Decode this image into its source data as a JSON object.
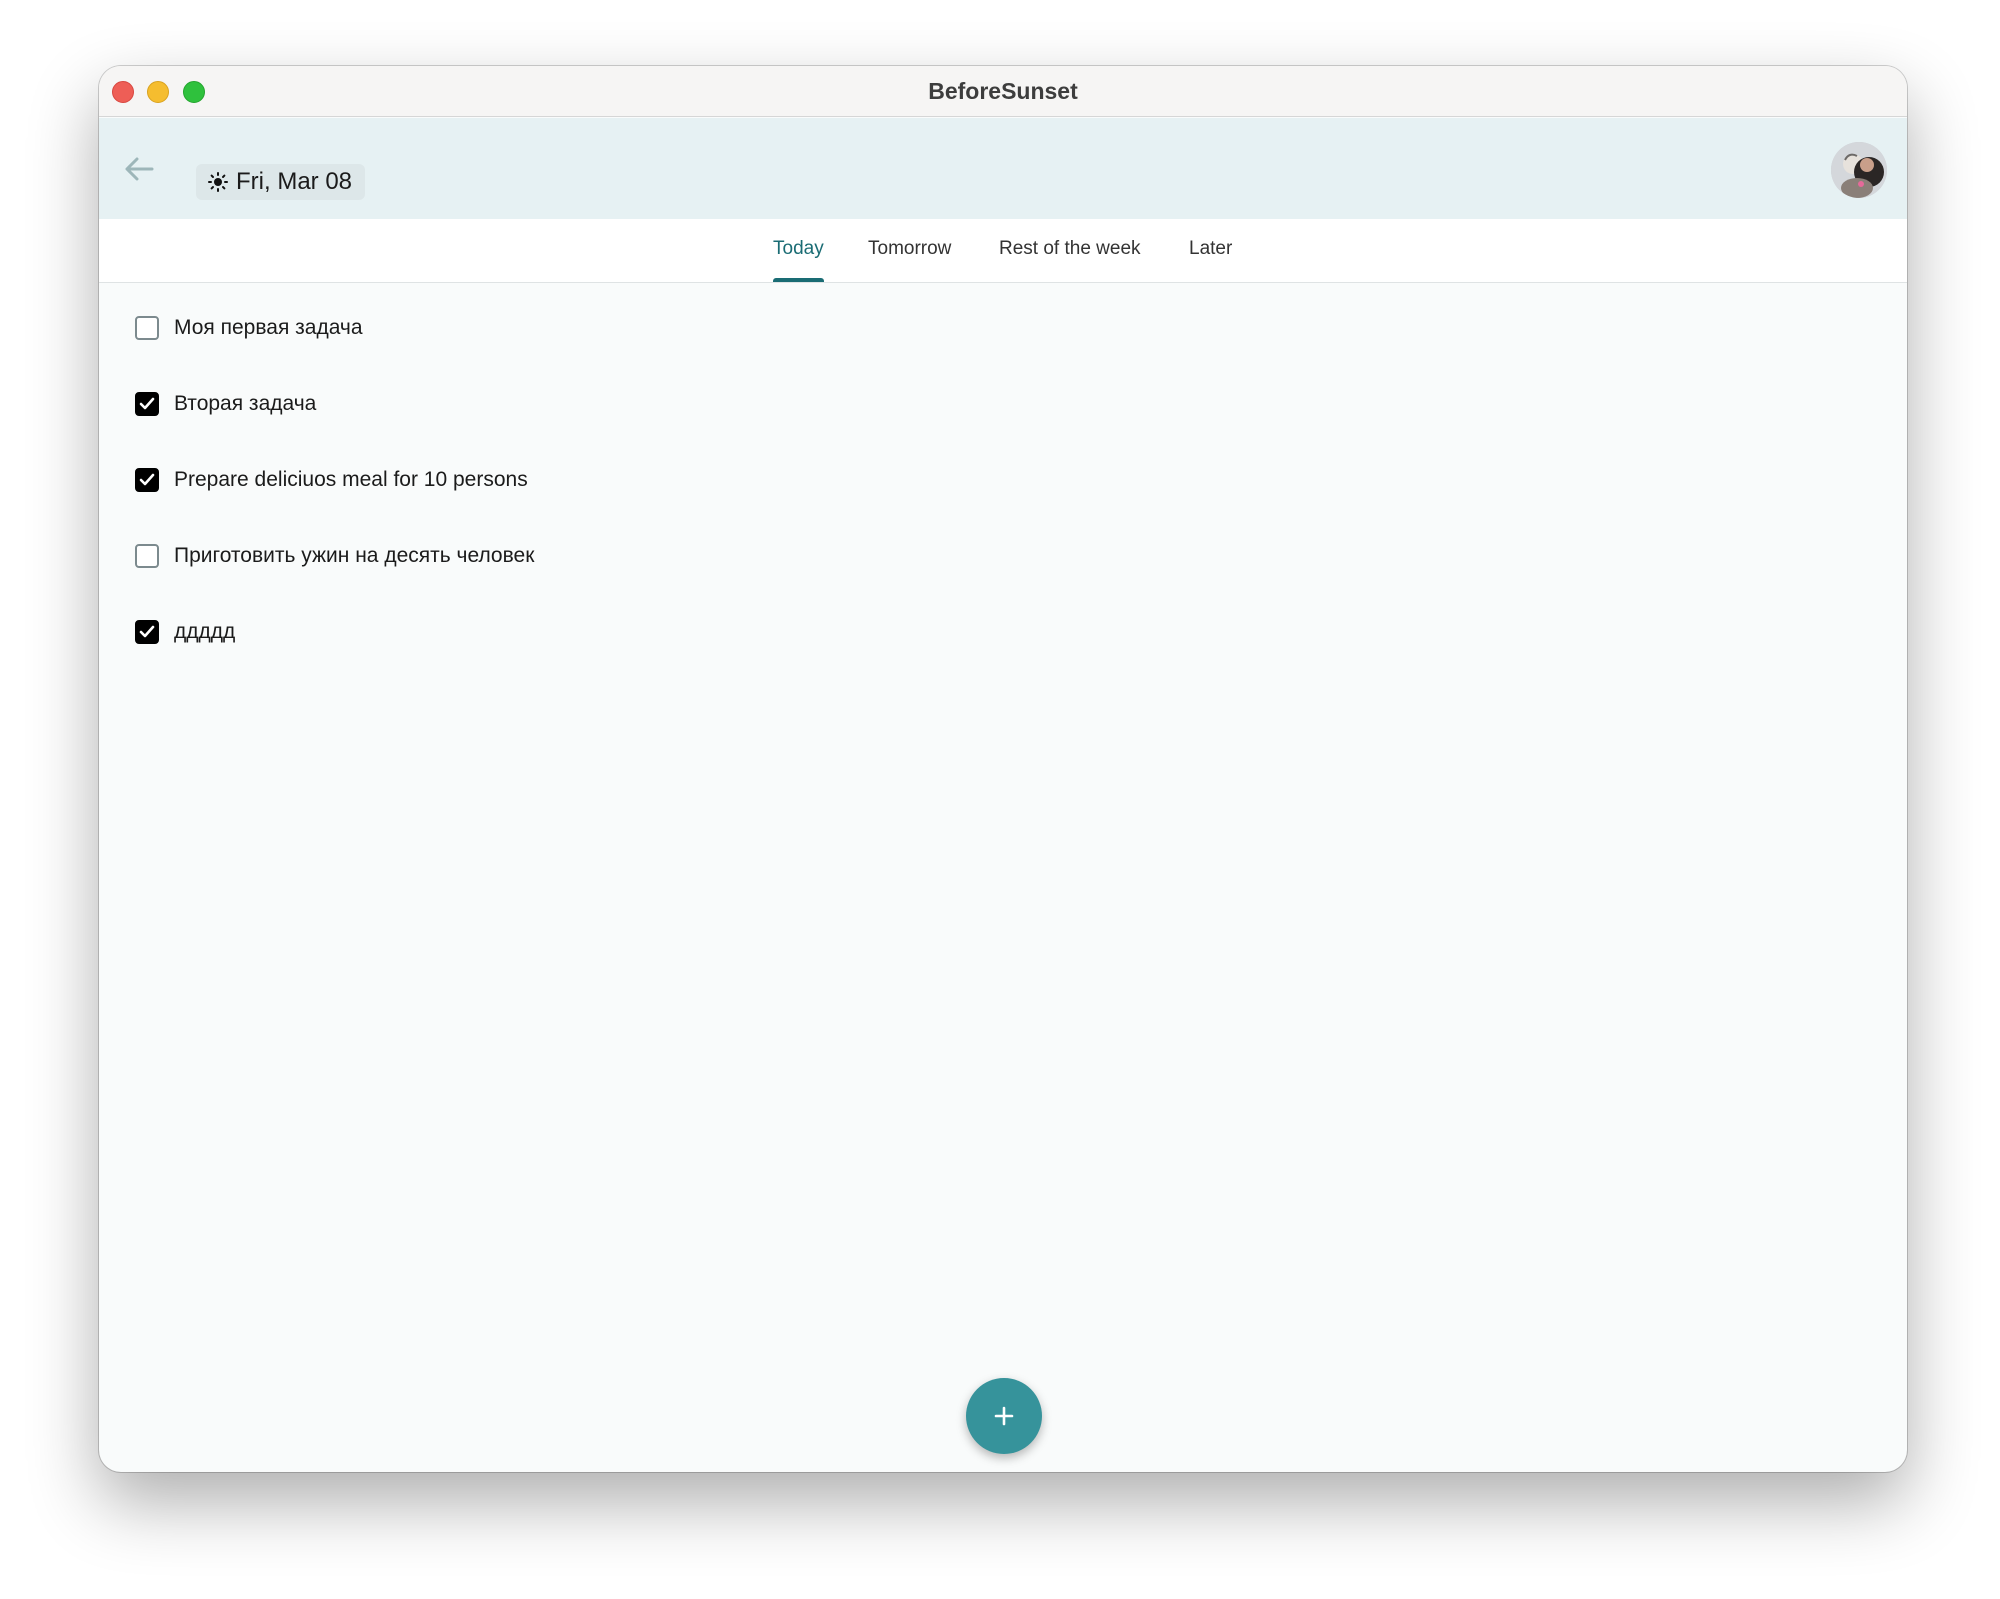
{
  "window": {
    "title": "BeforeSunset"
  },
  "header": {
    "date_label": "Fri, Mar 08",
    "icons": {
      "back": "arrow-left-icon",
      "weather": "sun-icon",
      "avatar": "user-avatar"
    }
  },
  "tabs": [
    {
      "label": "Today",
      "active": true
    },
    {
      "label": "Tomorrow",
      "active": false
    },
    {
      "label": "Rest of the week",
      "active": false
    },
    {
      "label": "Later",
      "active": false
    }
  ],
  "tasks": [
    {
      "label": "Моя первая задача",
      "done": false
    },
    {
      "label": "Вторая задача",
      "done": true
    },
    {
      "label": "Prepare deliciuos meal for 10 persons",
      "done": true
    },
    {
      "label": "Приготовить ужин на десять человек",
      "done": false
    },
    {
      "label": "ддддд",
      "done": true
    }
  ],
  "fab": {
    "icon": "plus-icon"
  },
  "colors": {
    "accent": "#1a6c74",
    "fab": "#36939b",
    "appbar": "#e6f1f3",
    "background": "#f9fbfb"
  }
}
